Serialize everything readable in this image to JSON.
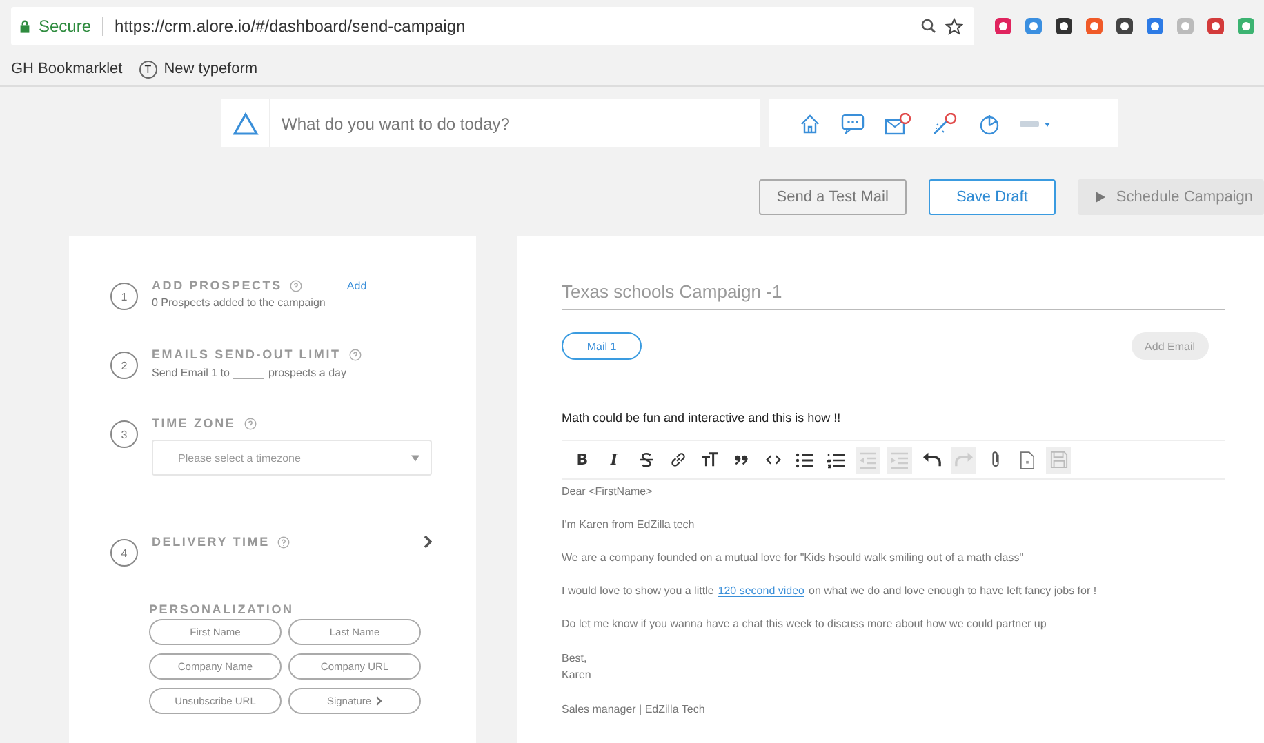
{
  "browser": {
    "secure_label": "Secure",
    "url": "https://crm.alore.io/#/dashboard/send-campaign"
  },
  "bookmarks": [
    {
      "label": "GH Bookmarklet",
      "kind": "plain"
    },
    {
      "label": "New typeform",
      "kind": "typeform",
      "glyph": "T"
    }
  ],
  "topbar": {
    "search_placeholder": "What do you want to do today?",
    "icons": [
      {
        "kind": "home"
      },
      {
        "kind": "chat"
      },
      {
        "kind": "mail"
      },
      {
        "kind": "wand"
      },
      {
        "kind": "pie"
      },
      {
        "kind": "account"
      }
    ]
  },
  "actions": [
    {
      "label": "Send a Test Mail",
      "kind": "outline"
    },
    {
      "label": "Save Draft",
      "kind": "primary"
    },
    {
      "label": "Schedule Campaign",
      "kind": "disabled"
    }
  ],
  "steps": [
    {
      "number": "1",
      "title": "ADD PROSPECTS",
      "kind": "prospects",
      "action": "Add",
      "text": "0 Prospects added to the campaign"
    },
    {
      "number": "2",
      "title": "EMAILS SEND-OUT LIMIT",
      "kind": "limit",
      "text_before": "Send Email 1 to",
      "text_after": "prospects a day"
    },
    {
      "number": "3",
      "title": "TIME ZONE",
      "kind": "select",
      "placeholder": "Please select a timezone"
    },
    {
      "number": "4",
      "title": "DELIVERY TIME",
      "kind": "expand"
    }
  ],
  "personalization": {
    "title": "PERSONALIZATION",
    "tags": [
      {
        "label": "First Name",
        "kind": "plain"
      },
      {
        "label": "Last Name",
        "kind": "plain"
      },
      {
        "label": "Company Name",
        "kind": "plain"
      },
      {
        "label": "Company URL",
        "kind": "plain"
      },
      {
        "label": "Unsubscribe URL",
        "kind": "plain"
      },
      {
        "label": "Signature",
        "kind": "submenu"
      }
    ]
  },
  "campaign": {
    "name": "Texas schools Campaign -1",
    "mails": [
      {
        "label": "Mail 1",
        "selected": true
      }
    ],
    "add_email": "Add Email",
    "subject": "Math could be fun and interactive and this is how !!",
    "toolbar": [
      {
        "kind": "bold",
        "glyph": "B",
        "disabled": false
      },
      {
        "kind": "italic",
        "glyph": "I",
        "disabled": false
      },
      {
        "kind": "strike",
        "disabled": false
      },
      {
        "kind": "link",
        "disabled": false
      },
      {
        "kind": "fontsize",
        "disabled": false
      },
      {
        "kind": "quote",
        "disabled": false
      },
      {
        "kind": "code",
        "disabled": false
      },
      {
        "kind": "bullets",
        "disabled": false
      },
      {
        "kind": "numbers",
        "disabled": false
      },
      {
        "kind": "outdent",
        "disabled": true
      },
      {
        "kind": "indent",
        "disabled": true
      },
      {
        "kind": "undo",
        "disabled": false
      },
      {
        "kind": "redo",
        "disabled": true
      },
      {
        "kind": "attach",
        "disabled": false
      },
      {
        "kind": "file",
        "disabled": false
      },
      {
        "kind": "save",
        "disabled": true
      }
    ],
    "body": [
      {
        "kind": "text",
        "text": "Dear <FirstName>"
      },
      {
        "kind": "text",
        "text": "I'm Karen from EdZilla tech"
      },
      {
        "kind": "text",
        "text": "We are a company founded on a mutual love for \"Kids hsould walk smiling out of a math class\""
      },
      {
        "kind": "link",
        "before": "I would love to show you a little",
        "link": "120 second video",
        "after": "on what we do and love enough to have left fancy jobs for !"
      },
      {
        "kind": "text",
        "text": "Do let me know if you wanna have a chat this week to discuss more about how we could partner up"
      },
      {
        "kind": "lines",
        "lines": [
          "Best,",
          "Karen"
        ]
      },
      {
        "kind": "text",
        "text": "Sales manager | EdZilla Tech"
      }
    ]
  }
}
